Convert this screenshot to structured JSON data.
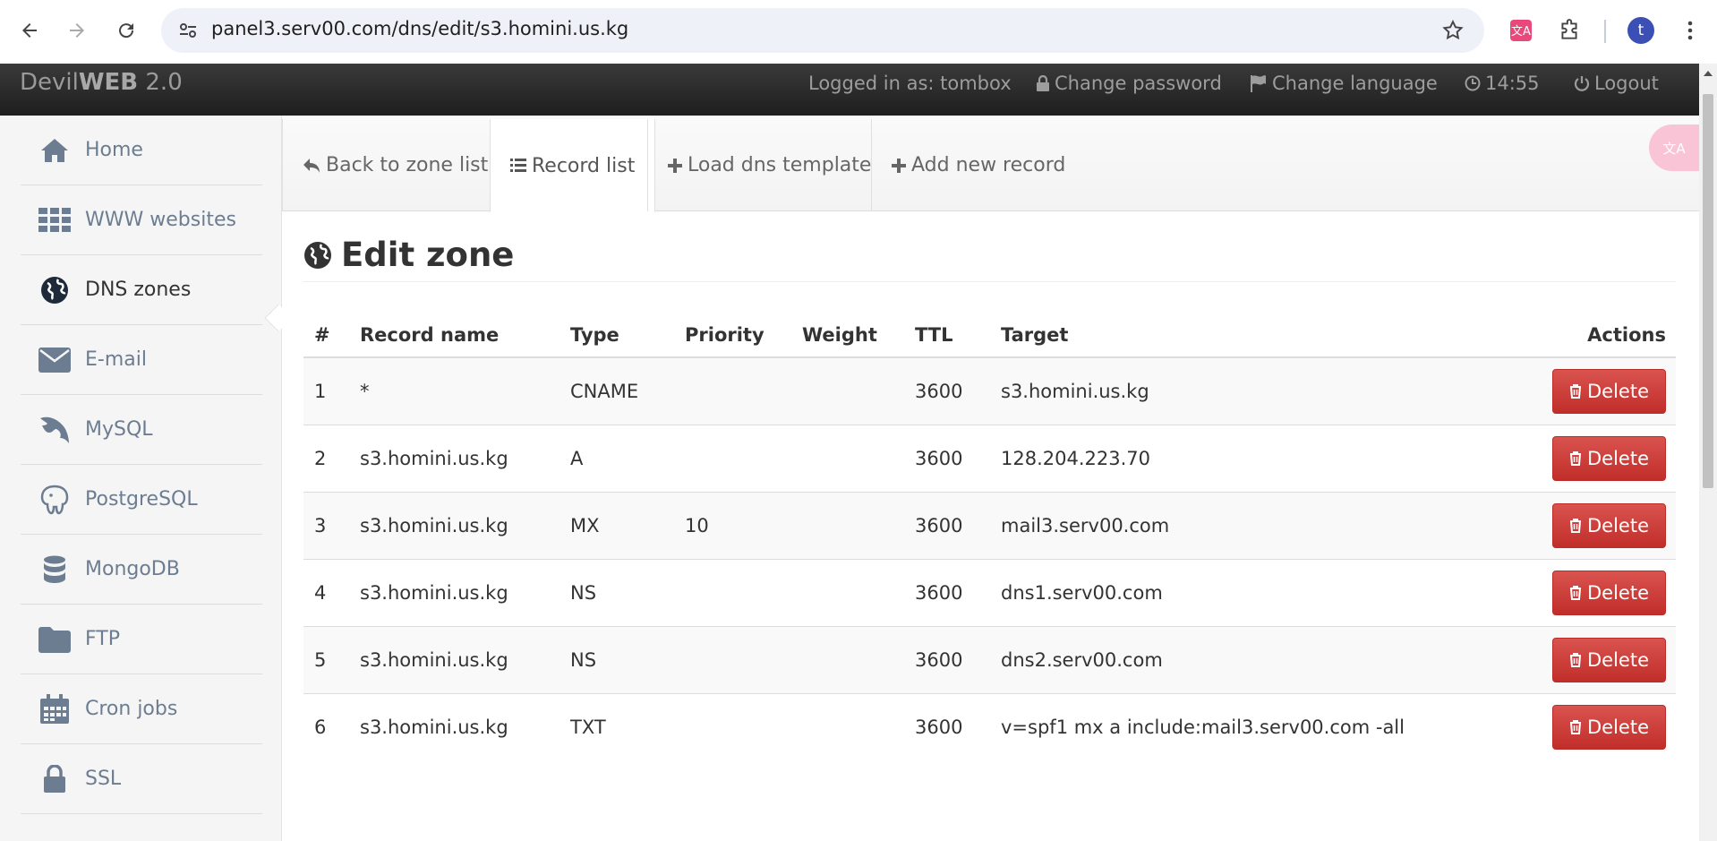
{
  "browser": {
    "url": "panel3.serv00.com/dns/edit/s3.homini.us.kg",
    "avatar_letter": "t"
  },
  "topbar": {
    "brand_pre": "Devil",
    "brand_bold": "WEB",
    "brand_post": " 2.0",
    "logged_in": "Logged in as: tombox",
    "change_password": "Change password",
    "change_language": "Change language",
    "time": "14:55",
    "logout": "Logout"
  },
  "sidebar": {
    "items": [
      {
        "label": "Home",
        "icon": "home-icon"
      },
      {
        "label": "WWW websites",
        "icon": "grid-icon"
      },
      {
        "label": "DNS zones",
        "icon": "globe-icon"
      },
      {
        "label": "E-mail",
        "icon": "envelope-icon"
      },
      {
        "label": "MySQL",
        "icon": "dolphin-icon"
      },
      {
        "label": "PostgreSQL",
        "icon": "elephant-icon"
      },
      {
        "label": "MongoDB",
        "icon": "database-icon"
      },
      {
        "label": "FTP",
        "icon": "folder-icon"
      },
      {
        "label": "Cron jobs",
        "icon": "calendar-icon"
      },
      {
        "label": "SSL",
        "icon": "lock-icon"
      }
    ]
  },
  "tabs": {
    "back": "Back to zone list",
    "records": "Record list",
    "template": "Load dns template",
    "add": "Add new record"
  },
  "page": {
    "title": "Edit zone"
  },
  "table": {
    "headers": {
      "num": "#",
      "name": "Record name",
      "type": "Type",
      "priority": "Priority",
      "weight": "Weight",
      "ttl": "TTL",
      "target": "Target",
      "actions": "Actions"
    },
    "delete_label": "Delete",
    "rows": [
      {
        "num": "1",
        "name": "*",
        "type": "CNAME",
        "priority": "",
        "weight": "",
        "ttl": "3600",
        "target": "s3.homini.us.kg"
      },
      {
        "num": "2",
        "name": "s3.homini.us.kg",
        "type": "A",
        "priority": "",
        "weight": "",
        "ttl": "3600",
        "target": "128.204.223.70"
      },
      {
        "num": "3",
        "name": "s3.homini.us.kg",
        "type": "MX",
        "priority": "10",
        "weight": "",
        "ttl": "3600",
        "target": "mail3.serv00.com"
      },
      {
        "num": "4",
        "name": "s3.homini.us.kg",
        "type": "NS",
        "priority": "",
        "weight": "",
        "ttl": "3600",
        "target": "dns1.serv00.com"
      },
      {
        "num": "5",
        "name": "s3.homini.us.kg",
        "type": "NS",
        "priority": "",
        "weight": "",
        "ttl": "3600",
        "target": "dns2.serv00.com"
      },
      {
        "num": "6",
        "name": "s3.homini.us.kg",
        "type": "TXT",
        "priority": "",
        "weight": "",
        "ttl": "3600",
        "target": "v=spf1 mx a include:mail3.serv00.com -all"
      }
    ]
  },
  "colors": {
    "delete_red": "#d9534f",
    "sidebar_text": "#6d7d91",
    "topbar_bg": "#222222"
  }
}
